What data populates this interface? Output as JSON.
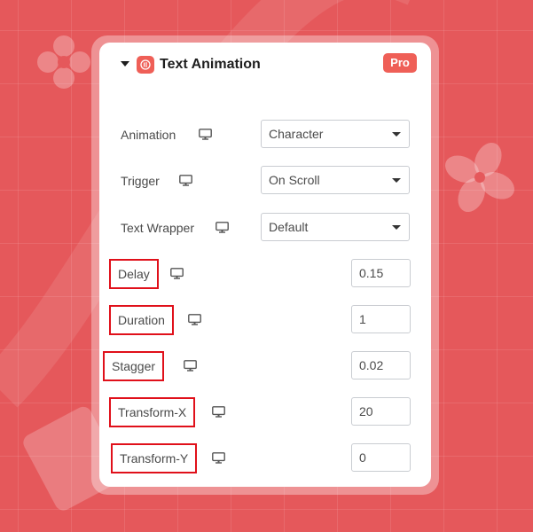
{
  "panel": {
    "title": "Text Animation",
    "badge": "Pro"
  },
  "rows": [
    {
      "label": "Animation",
      "value": "Character"
    },
    {
      "label": "Trigger",
      "value": "On Scroll"
    },
    {
      "label": "Text Wrapper",
      "value": "Default"
    },
    {
      "label": "Delay",
      "value": "0.15"
    },
    {
      "label": "Duration",
      "value": "1"
    },
    {
      "label": "Stagger",
      "value": "0.02"
    },
    {
      "label": "Transform-X",
      "value": "20"
    },
    {
      "label": "Transform-Y",
      "value": "0"
    }
  ],
  "colors": {
    "background": "#e5585b",
    "accent": "#ef5f57",
    "highlight_border": "#e0101a"
  },
  "icons": {
    "collapse": "caret-down-icon",
    "brand": "elementor-icon",
    "responsive": "monitor-icon",
    "dropdown": "chevron-down-icon"
  }
}
